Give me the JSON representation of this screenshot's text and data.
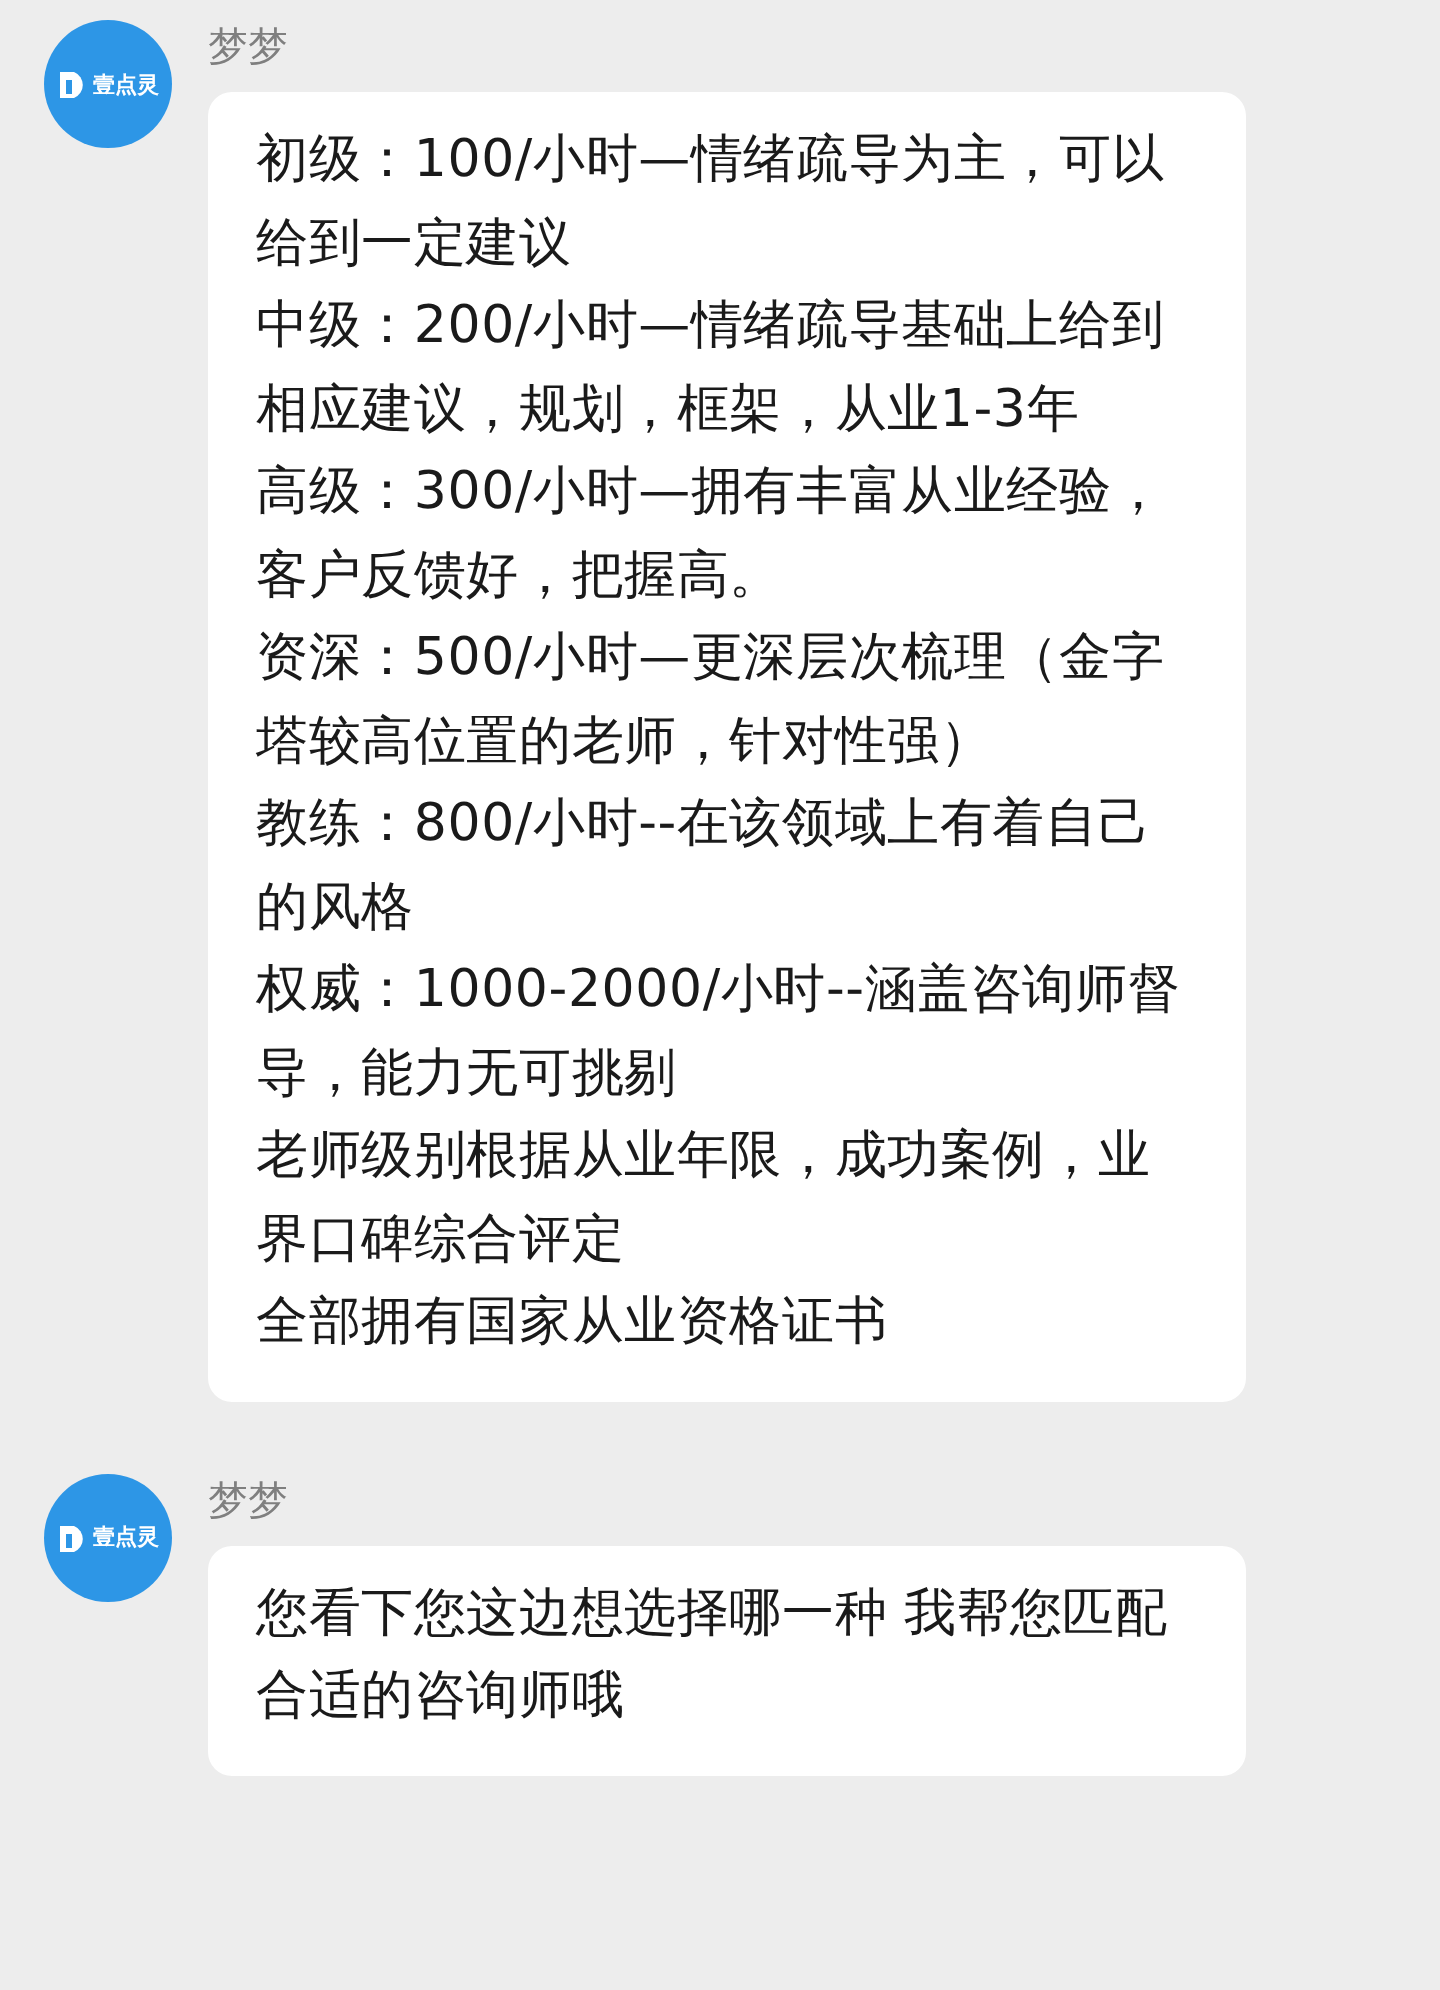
{
  "messages": [
    {
      "sender": "梦梦",
      "avatar_text": "壹点灵",
      "lines": [
        "初级：100/小时—情绪疏导为主，可以给到一定建议",
        "中级：200/小时—情绪疏导基础上给到相应建议，规划，框架，从业1-3年",
        "高级：300/小时—拥有丰富从业经验，客户反馈好，把握高。",
        "资深：500/小时—更深层次梳理（金字塔较高位置的老师，针对性强）",
        "教练：800/小时--在该领域上有着自己的风格",
        "权威：1000-2000/小时--涵盖咨询师督导，能力无可挑剔",
        "老师级别根据从业年限，成功案例，业界口碑综合评定",
        "全部拥有国家从业资格证书"
      ]
    },
    {
      "sender": "梦梦",
      "avatar_text": "壹点灵",
      "lines": [
        "您看下您这边想选择哪一种 我帮您匹配合适的咨询师哦"
      ]
    }
  ]
}
